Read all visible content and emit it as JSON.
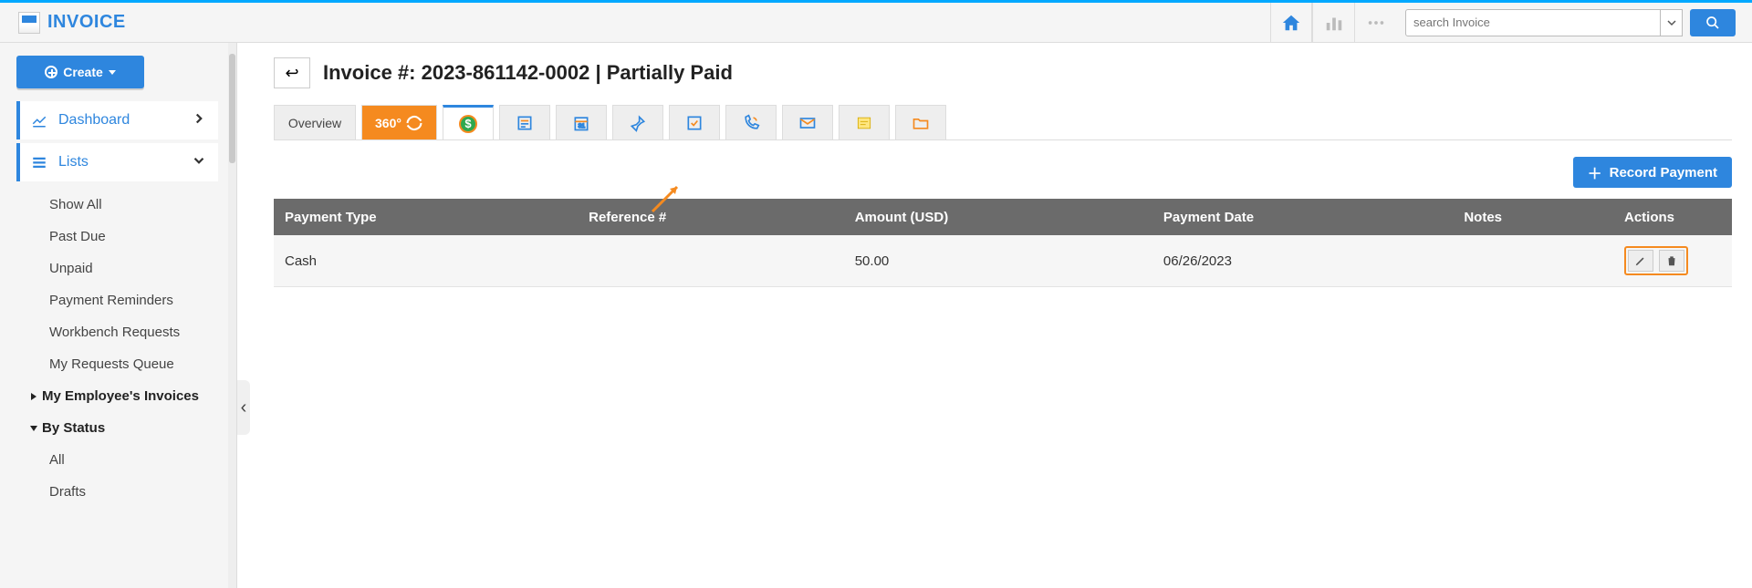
{
  "app": {
    "title": "INVOICE"
  },
  "header": {
    "search_placeholder": "search Invoice"
  },
  "sidebar": {
    "create_label": "Create",
    "nav": {
      "dashboard": "Dashboard",
      "lists": "Lists"
    },
    "list_items": [
      "Show All",
      "Past Due",
      "Unpaid",
      "Payment Reminders",
      "Workbench Requests",
      "My Requests Queue"
    ],
    "groups": {
      "employees": "My Employee's Invoices",
      "bystatus": "By Status"
    },
    "bystatus_items": [
      "All",
      "Drafts"
    ]
  },
  "main": {
    "title": "Invoice #: 2023-861142-0002 | Partially Paid",
    "tabs": {
      "overview": "Overview",
      "t360": "360°"
    },
    "record_btn": "Record Payment",
    "table": {
      "columns": [
        "Payment Type",
        "Reference #",
        "Amount (USD)",
        "Payment Date",
        "Notes",
        "Actions"
      ],
      "rows": [
        {
          "payment_type": "Cash",
          "reference": "",
          "amount": "50.00",
          "date": "06/26/2023",
          "notes": ""
        }
      ]
    }
  }
}
